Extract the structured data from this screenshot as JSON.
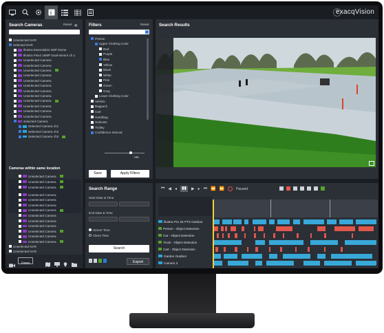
{
  "topbar": {
    "brand": "exacqVision",
    "help": "?"
  },
  "search_cameras": {
    "title": "Search Cameras",
    "reset": "Reset",
    "collapse": "«",
    "tree": [
      {
        "label": "Unselected NVR",
        "level": 0,
        "checked": false,
        "cam": "",
        "tag": false
      },
      {
        "label": "Selected NVR",
        "level": 0,
        "checked": true,
        "cam": "",
        "tag": false
      },
      {
        "label": "Illustra Essentials4 2MP Dome",
        "level": 1,
        "checked": false,
        "cam": "#8c39c8",
        "tag": false
      },
      {
        "label": "Illustra Flex4 16MP Dual-sensor ch 1",
        "level": 1,
        "checked": false,
        "cam": "#8c39c8",
        "tag": false
      },
      {
        "label": "Unselected Camera",
        "level": 1,
        "checked": false,
        "cam": "#8c39c8",
        "tag": false
      },
      {
        "label": "Unselected Camera",
        "level": 1,
        "checked": false,
        "cam": "#8c39c8",
        "tag": false
      },
      {
        "label": "Unselected Camera",
        "level": 1,
        "checked": false,
        "cam": "#8c39c8",
        "tag": true
      },
      {
        "label": "Unselected Camera",
        "level": 1,
        "checked": false,
        "cam": "#8c39c8",
        "tag": false
      },
      {
        "label": "Unselected Camera",
        "level": 1,
        "checked": false,
        "cam": "#8c39c8",
        "tag": false
      },
      {
        "label": "Unselected Camera",
        "level": 1,
        "checked": false,
        "cam": "#8c39c8",
        "tag": false
      },
      {
        "label": "Unselected Camera",
        "level": 1,
        "checked": false,
        "cam": "#8c39c8",
        "tag": false
      },
      {
        "label": "Unselected Camera",
        "level": 1,
        "checked": false,
        "cam": "#8c39c8",
        "tag": false
      },
      {
        "label": "Unselected Camera",
        "level": 1,
        "checked": false,
        "cam": "#8c39c8",
        "tag": true
      },
      {
        "label": "Unselected Camera",
        "level": 1,
        "checked": false,
        "cam": "#8c39c8",
        "tag": false
      },
      {
        "label": "Unselected Camera",
        "level": 1,
        "checked": false,
        "cam": "#8c39c8",
        "tag": false
      },
      {
        "label": "Unselected Camera",
        "level": 1,
        "checked": false,
        "cam": "#8c39c8",
        "tag": false
      },
      {
        "label": "Selected Camera",
        "level": 1,
        "checked": true,
        "cam": "#8c39c8",
        "tag": false
      },
      {
        "label": "Selected Camera ch1",
        "level": 2,
        "checked": true,
        "cam": "#2aa4d6",
        "tag": false
      },
      {
        "label": "Selected Camera ch2",
        "level": 2,
        "checked": true,
        "cam": "#2aa4d6",
        "tag": false
      },
      {
        "label": "Selected Camera ch2",
        "level": 2,
        "checked": true,
        "cam": "#2aa4d6",
        "tag": true
      }
    ],
    "same_location_title": "Cameras within same location",
    "location_rows": [
      {
        "label": "Unselected Camera",
        "tag": true
      },
      {
        "label": "Unselected Camera",
        "tag": true
      },
      {
        "label": "Unselected Camera",
        "tag": true
      }
    ],
    "lower_rows": [
      {
        "label": "Unselected Camera",
        "tag": false
      },
      {
        "label": "Unselected Camera",
        "tag": false
      },
      {
        "label": "Unselected Camera",
        "tag": false
      },
      {
        "label": "Unselected Camera",
        "tag": true
      },
      {
        "label": "Unselected Camera",
        "tag": false
      },
      {
        "label": "Unselected Camera",
        "tag": false
      },
      {
        "label": "Unselected Camera",
        "tag": false
      },
      {
        "label": "Unselected Camera",
        "tag": true
      },
      {
        "label": "Unselected Camera",
        "tag": false
      },
      {
        "label": "Unselected Camera",
        "tag": true
      }
    ],
    "bottom_nvrs": [
      "Unselected NVR",
      "Unselected NVR"
    ],
    "footer_groups": "Groups"
  },
  "filters": {
    "title": "Filters",
    "reset": "Reset",
    "items": [
      {
        "label": "Person",
        "level": 0,
        "checked": true
      },
      {
        "label": "Upper Clothing Color",
        "level": 1,
        "checked": true
      },
      {
        "label": "Red",
        "level": 2,
        "checked": false
      },
      {
        "label": "Purple",
        "level": 2,
        "checked": false
      },
      {
        "label": "Blue",
        "level": 2,
        "checked": true
      },
      {
        "label": "Yellow",
        "level": 2,
        "checked": false
      },
      {
        "label": "Black",
        "level": 2,
        "checked": false
      },
      {
        "label": "White",
        "level": 2,
        "checked": false
      },
      {
        "label": "Pink",
        "level": 2,
        "checked": false
      },
      {
        "label": "Green",
        "level": 2,
        "checked": false
      },
      {
        "label": "Gray",
        "level": 2,
        "checked": false
      },
      {
        "label": "Lower Clothing Color",
        "level": 1,
        "checked": false
      },
      {
        "label": "Vehicle",
        "level": 0,
        "checked": false
      },
      {
        "label": "Bagpack",
        "level": 0,
        "checked": false
      },
      {
        "label": "Cart",
        "level": 0,
        "checked": false
      },
      {
        "label": "Handbag",
        "level": 0,
        "checked": false
      },
      {
        "label": "Suitcase",
        "level": 0,
        "checked": false
      },
      {
        "label": "Trolley",
        "level": 0,
        "checked": false
      },
      {
        "label": "Confidence Interval",
        "level": 0,
        "checked": true
      }
    ],
    "confidence": ">85",
    "confidence_level": 0.66,
    "save": "Save",
    "apply": "Apply Filters"
  },
  "results": {
    "title": "Search Results"
  },
  "search_range": {
    "title": "Search Range",
    "start_label": "Start Date & Time",
    "end_label": "End Date & Time",
    "server_time": "Server Time",
    "client_time": "Client Time",
    "search": "Search",
    "export": "Export"
  },
  "playback": {
    "status": "Paused"
  },
  "tracks": [
    {
      "label": "Illustra Pro 4K PTZ Outdoor",
      "icon": "#2aa4d6",
      "tag": false
    },
    {
      "label": "Person - Object Detection",
      "icon": "",
      "tag": true
    },
    {
      "label": "Car - Object Detection",
      "icon": "",
      "tag": true
    },
    {
      "label": "Truck - Object Detection",
      "icon": "",
      "tag": true
    },
    {
      "label": "Cart - Object Detection",
      "icon": "",
      "tag": true
    },
    {
      "label": "Garden Outdoor",
      "icon": "#2aa4d6",
      "tag": false
    },
    {
      "label": "Camera 3",
      "icon": "#2aa4d6",
      "tag": false
    }
  ],
  "colors": {
    "camera_blue": "#2aa4d6",
    "camera_purple": "#8c39c8",
    "analytics_green": "#56a32b",
    "detect_red": "#e2574c",
    "timeline_blue": "#38a8d8",
    "dark": "#1a1d22"
  }
}
